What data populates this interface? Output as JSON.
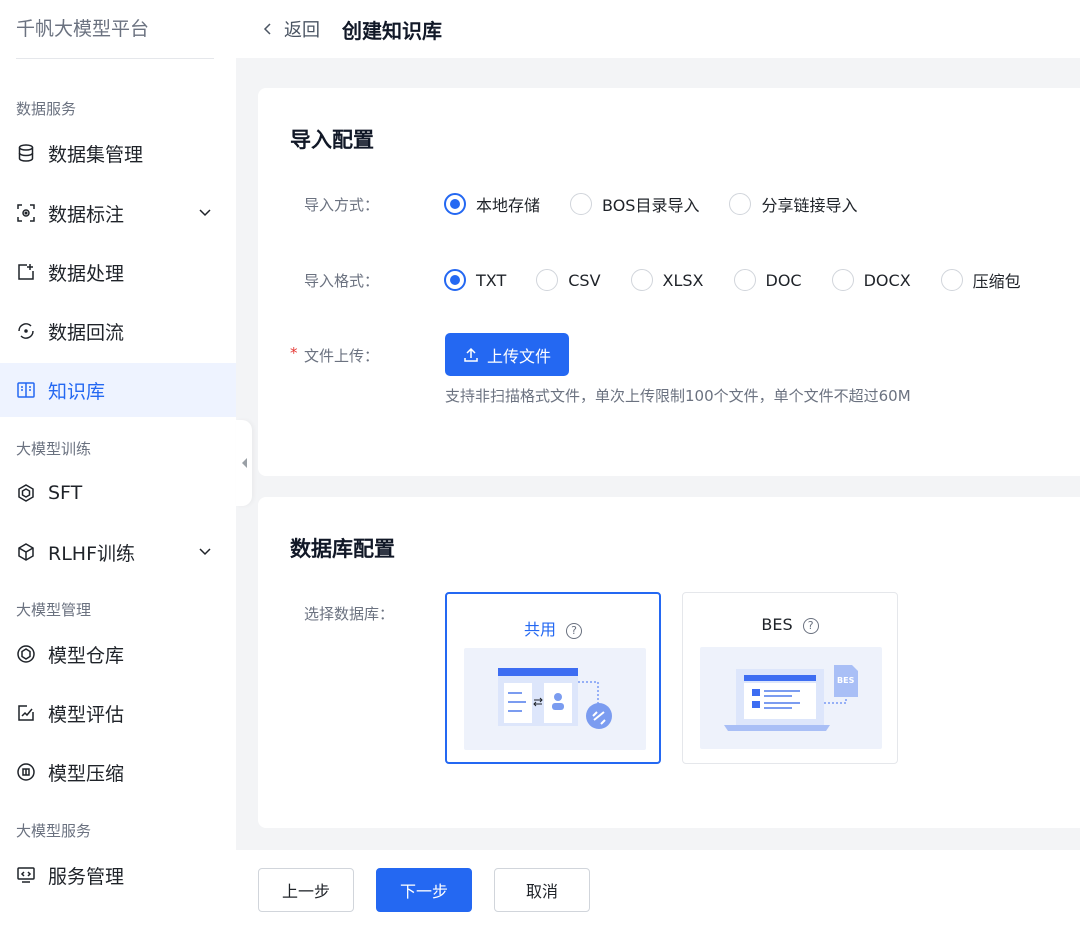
{
  "sidebar": {
    "brand": "千帆大模型平台",
    "sections": {
      "data_service": "数据服务",
      "model_training": "大模型训练",
      "model_management": "大模型管理",
      "model_service": "大模型服务"
    },
    "items": [
      {
        "label": "数据集管理",
        "icon": "database-icon"
      },
      {
        "label": "数据标注",
        "icon": "scan-icon"
      },
      {
        "label": "数据处理",
        "icon": "process-icon"
      },
      {
        "label": "数据回流",
        "icon": "refresh-icon"
      },
      {
        "label": "知识库",
        "icon": "book-icon"
      },
      {
        "label": "SFT",
        "icon": "hexagon-icon"
      },
      {
        "label": "RLHF训练",
        "icon": "cube-icon"
      },
      {
        "label": "模型仓库",
        "icon": "package-icon"
      },
      {
        "label": "模型评估",
        "icon": "chart-icon"
      },
      {
        "label": "模型压缩",
        "icon": "compress-icon"
      },
      {
        "label": "服务管理",
        "icon": "monitor-icon"
      }
    ]
  },
  "header": {
    "back_label": "返回",
    "title": "创建知识库"
  },
  "import_config": {
    "title": "导入配置",
    "method_label": "导入方式：",
    "methods": [
      "本地存储",
      "BOS目录导入",
      "分享链接导入"
    ],
    "format_label": "导入格式：",
    "formats": [
      "TXT",
      "CSV",
      "XLSX",
      "DOC",
      "DOCX",
      "压缩包"
    ],
    "upload_label": "文件上传：",
    "required_mark": "*",
    "upload_button": "上传文件",
    "hint": "支持非扫描格式文件，单次上传限制100个文件，单个文件不超过60M"
  },
  "db_config": {
    "title": "数据库配置",
    "select_label": "选择数据库：",
    "options": [
      {
        "name": "共用",
        "help": "?"
      },
      {
        "name": "BES",
        "help": "?",
        "badge": "BES"
      }
    ]
  },
  "footer": {
    "prev": "上一步",
    "next": "下一步",
    "cancel": "取消"
  },
  "colors": {
    "accent": "#2468f2",
    "active_bg": "#eef3ff"
  }
}
